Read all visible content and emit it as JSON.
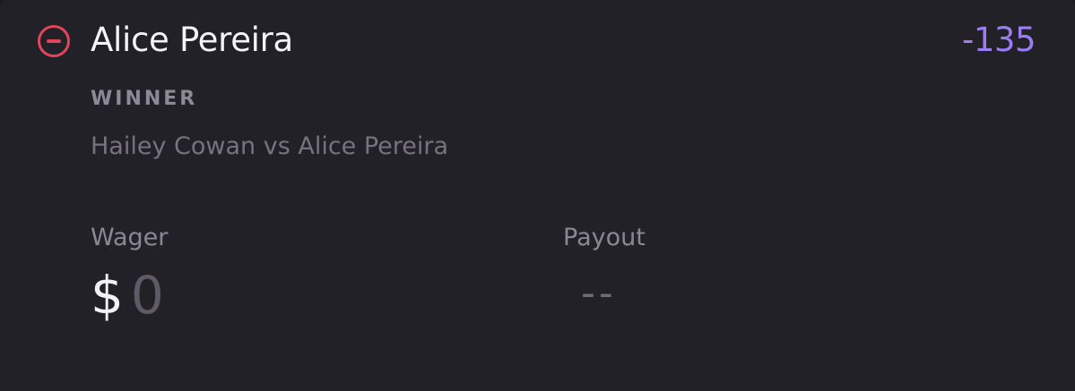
{
  "bet": {
    "selection": "Alice Pereira",
    "odds": "-135",
    "market": "WINNER",
    "matchup": "Hailey Cowan vs Alice Pereira"
  },
  "wager": {
    "label": "Wager",
    "currency_symbol": "$",
    "value": "",
    "placeholder": "0"
  },
  "payout": {
    "label": "Payout",
    "value": "--"
  },
  "icons": {
    "remove": "minus-circle-icon"
  },
  "colors": {
    "remove": "#e0465a",
    "odds": "#9a7cf4",
    "background": "#232128"
  }
}
